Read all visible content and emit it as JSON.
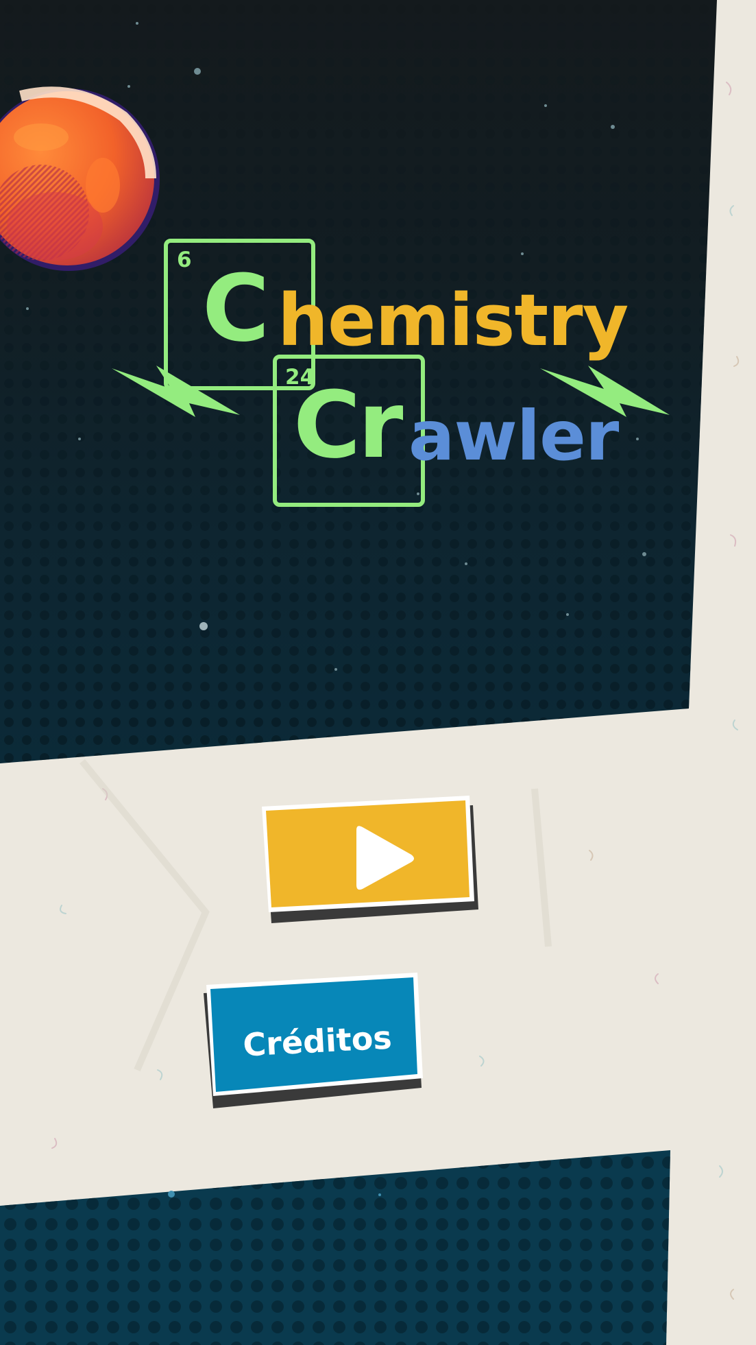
{
  "title": {
    "element1_number": "6",
    "element1_symbol": "C",
    "word1_rest": "hemistry",
    "element2_number": "24",
    "element2_symbol": "Cr",
    "word2_rest": "awler"
  },
  "menu": {
    "play_icon": "play-icon",
    "credits_label": "Créditos"
  },
  "colors": {
    "space_bg": "#0f1c22",
    "paper_bg": "#ece8df",
    "element_green": "#94ec7f",
    "chem_yellow": "#f0b62a",
    "crawl_blue": "#5b8ed8",
    "play_button": "#f0b62a",
    "credits_button": "#0787b8",
    "button_shadow": "#3a3a3a",
    "planet": "#f26a2a"
  }
}
